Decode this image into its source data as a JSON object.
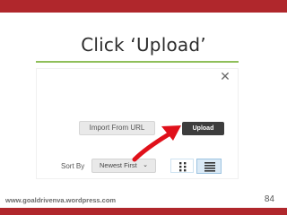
{
  "slide": {
    "title": "Click ‘Upload’",
    "footer_url": "www.goaldrivenva.wordpress.com",
    "page_number": "84"
  },
  "colors": {
    "accent_red": "#b0272c",
    "rule_green": "#8fbf5a",
    "upload_button": "#3d3d3d",
    "arrow_red": "#e0101a"
  },
  "screenshot": {
    "close_icon": "✕",
    "import_label": "Import From URL",
    "upload_label": "Upload",
    "sort_label": "Sort By",
    "sort_value": "Newest First",
    "sort_chevron": "⌄",
    "view_modes": [
      "grid-view-icon",
      "list-view-icon"
    ],
    "selected_view": "list"
  }
}
